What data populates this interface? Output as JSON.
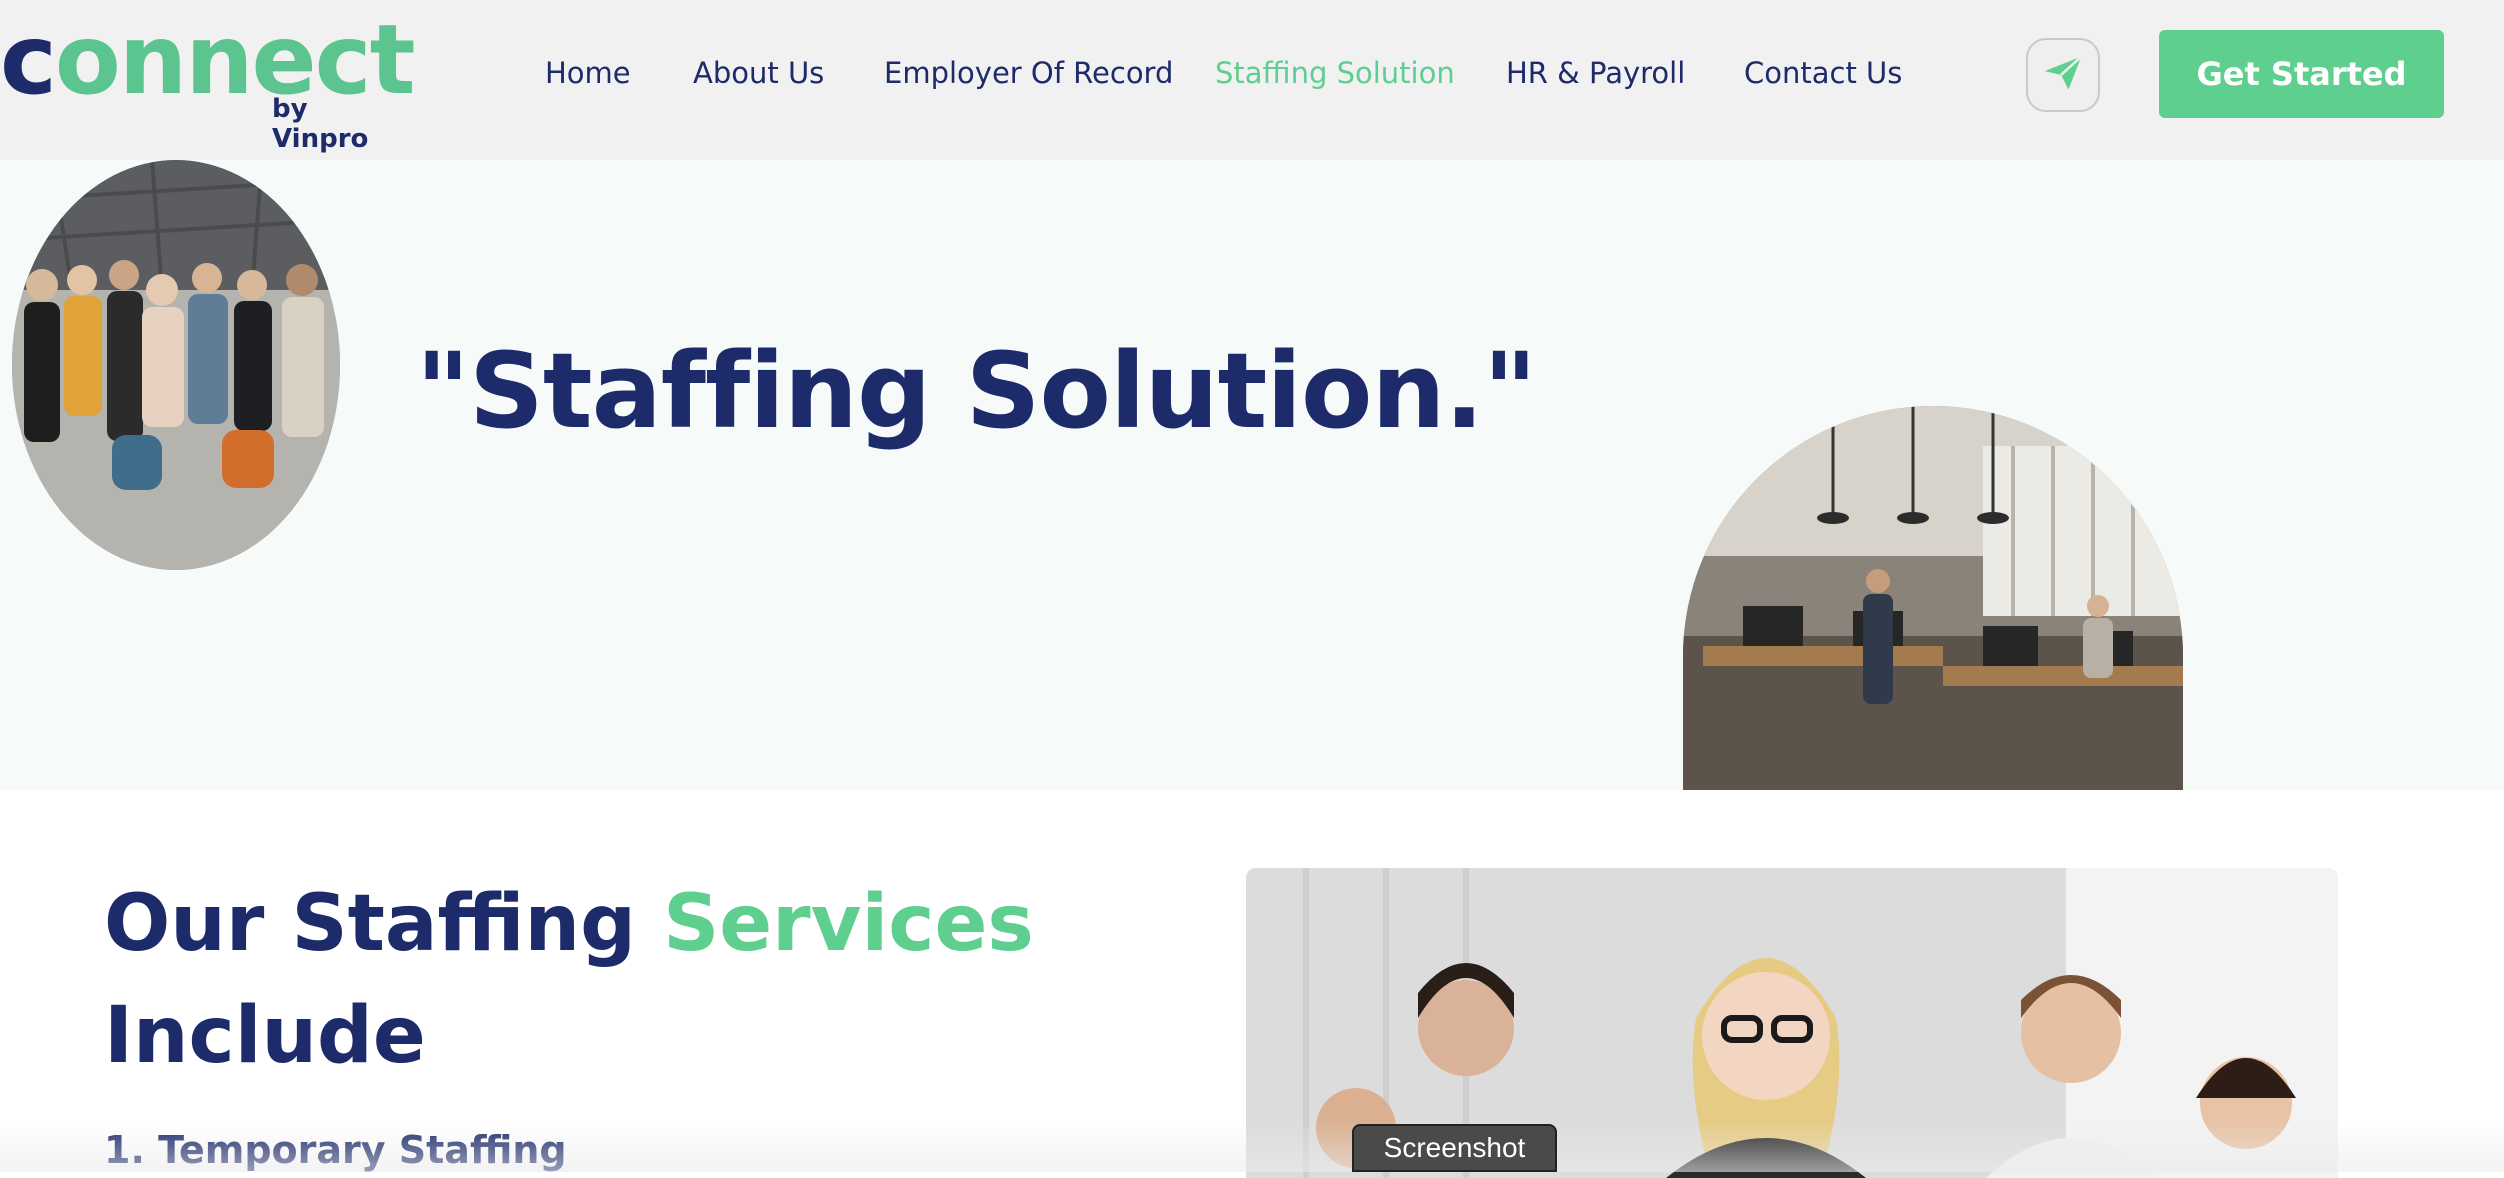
{
  "brand": {
    "logo_word": "connect",
    "logo_first_letter": "c",
    "logo_rest": "onnect",
    "logo_sub": "by Vinpro",
    "primary_color": "#1d2b6b",
    "accent_color": "#5fcf8f"
  },
  "nav": {
    "items": [
      {
        "label": "Home",
        "active": false
      },
      {
        "label": "About Us",
        "active": false
      },
      {
        "label": "Employer Of Record",
        "active": false
      },
      {
        "label": "Staffing Solution",
        "active": true
      },
      {
        "label": "HR & Payroll",
        "active": false
      },
      {
        "label": "Contact Us",
        "active": false
      }
    ],
    "send_icon": "paper-plane-icon",
    "cta_label": "Get Started"
  },
  "hero": {
    "title": "\"Staffing Solution.\"",
    "image_left": "team-group-photo",
    "image_right": "open-office-photo"
  },
  "services": {
    "title_part1": "Our Staffing ",
    "title_accent": "Services",
    "title_part2": "Include",
    "first_item": "1. Temporary Staffing",
    "image": "team-meeting-photo"
  },
  "overlay": {
    "tooltip": "Screenshot"
  }
}
